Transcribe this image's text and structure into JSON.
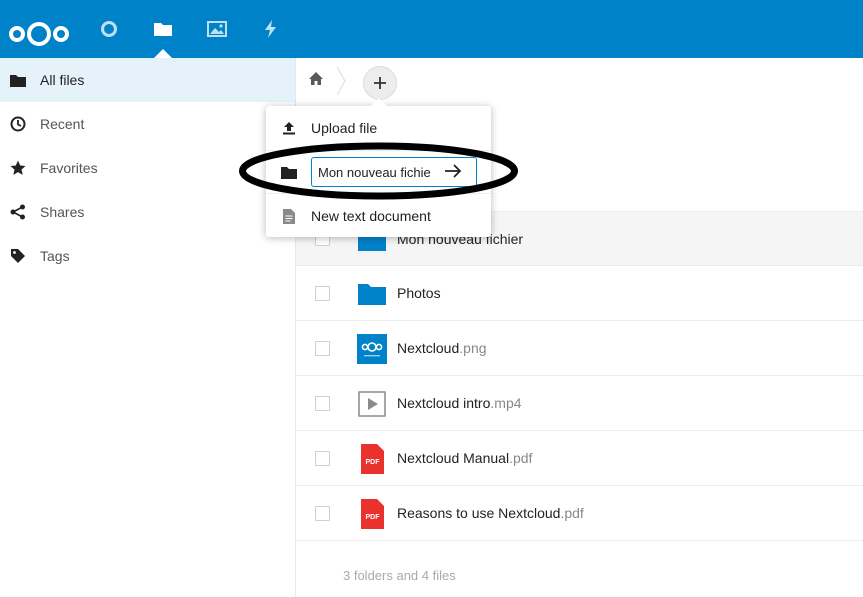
{
  "header": {
    "logo": "nextcloud-logo",
    "apps": [
      {
        "name": "Dashboard",
        "icon": "circle-icon"
      },
      {
        "name": "Files",
        "icon": "folder-icon",
        "active": true
      },
      {
        "name": "Photos",
        "icon": "image-icon"
      },
      {
        "name": "Activity",
        "icon": "lightning-icon"
      }
    ]
  },
  "sidebar": {
    "items": [
      {
        "label": "All files",
        "icon": "folder-icon",
        "active": true
      },
      {
        "label": "Recent",
        "icon": "clock-icon"
      },
      {
        "label": "Favorites",
        "icon": "star-icon"
      },
      {
        "label": "Shares",
        "icon": "share-icon"
      },
      {
        "label": "Tags",
        "icon": "tag-icon"
      }
    ]
  },
  "new_menu": {
    "upload_label": "Upload file",
    "new_folder_value": "Mon nouveau fichie",
    "new_text_label": "New text document"
  },
  "files": [
    {
      "name": "Mon nouveau fichier",
      "ext": "",
      "type": "folder"
    },
    {
      "name": "Photos",
      "ext": "",
      "type": "folder"
    },
    {
      "name": "Nextcloud",
      "ext": ".png",
      "type": "image"
    },
    {
      "name": "Nextcloud intro",
      "ext": ".mp4",
      "type": "video"
    },
    {
      "name": "Nextcloud Manual",
      "ext": ".pdf",
      "type": "pdf"
    },
    {
      "name": "Reasons to use Nextcloud",
      "ext": ".pdf",
      "type": "pdf"
    }
  ],
  "pdf_badge": "PDF",
  "summary": "3 folders and 4 files",
  "colors": {
    "primary": "#0082c9",
    "folder": "#0082c9",
    "pdf": "#e9322d",
    "annotation": "#000000"
  }
}
